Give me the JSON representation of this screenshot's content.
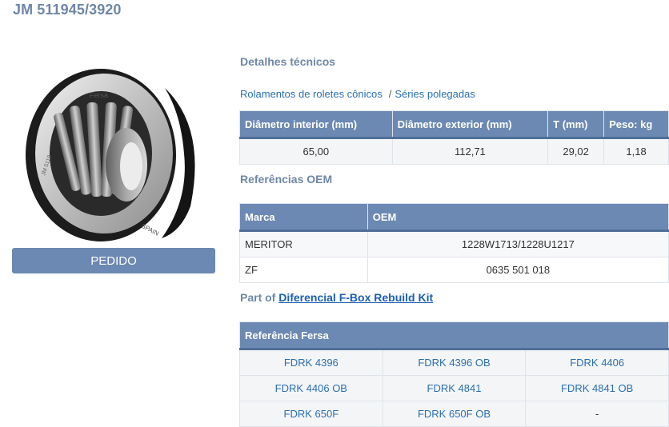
{
  "product": {
    "title": "JM 511945/3920",
    "order_button": "PEDIDO"
  },
  "technical": {
    "heading": "Detalhes técnicos",
    "breadcrumb": [
      "Rolamentos de roletes cônicos",
      "Séries polegadas"
    ],
    "breadcrumb_separator": "/",
    "columns": [
      "Diâmetro interior (mm)",
      "Diâmetro exterior (mm)",
      "T (mm)",
      "Peso: kg"
    ],
    "row": [
      "65,00",
      "112,71",
      "29,02",
      "1,18"
    ]
  },
  "oem": {
    "heading": "Referências OEM",
    "columns": [
      "Marca",
      "OEM"
    ],
    "rows": [
      [
        "MERITOR",
        "1228W1713/1228U1217"
      ],
      [
        "ZF",
        "0635 501 018"
      ]
    ]
  },
  "part_of": {
    "prefix": "Part of",
    "link": "Diferencial F-Box Rebuild Kit"
  },
  "fersa_refs": {
    "heading": "Referência Fersa",
    "rows": [
      [
        "FDRK 4396",
        "FDRK 4396 OB",
        "FDRK 4406"
      ],
      [
        "FDRK 4406 OB",
        "FDRK 4841",
        "FDRK 4841 OB"
      ],
      [
        "FDRK 650F",
        "FDRK 650F OB",
        "-"
      ]
    ]
  },
  "image": {
    "ring_text_outer": "Fersa",
    "ring_text_side": "SPAIN",
    "ring_text_code": "JM 5119"
  },
  "colors": {
    "accent": "#6b89b2",
    "heading": "#6e87a7",
    "link": "#2a6fb0"
  }
}
